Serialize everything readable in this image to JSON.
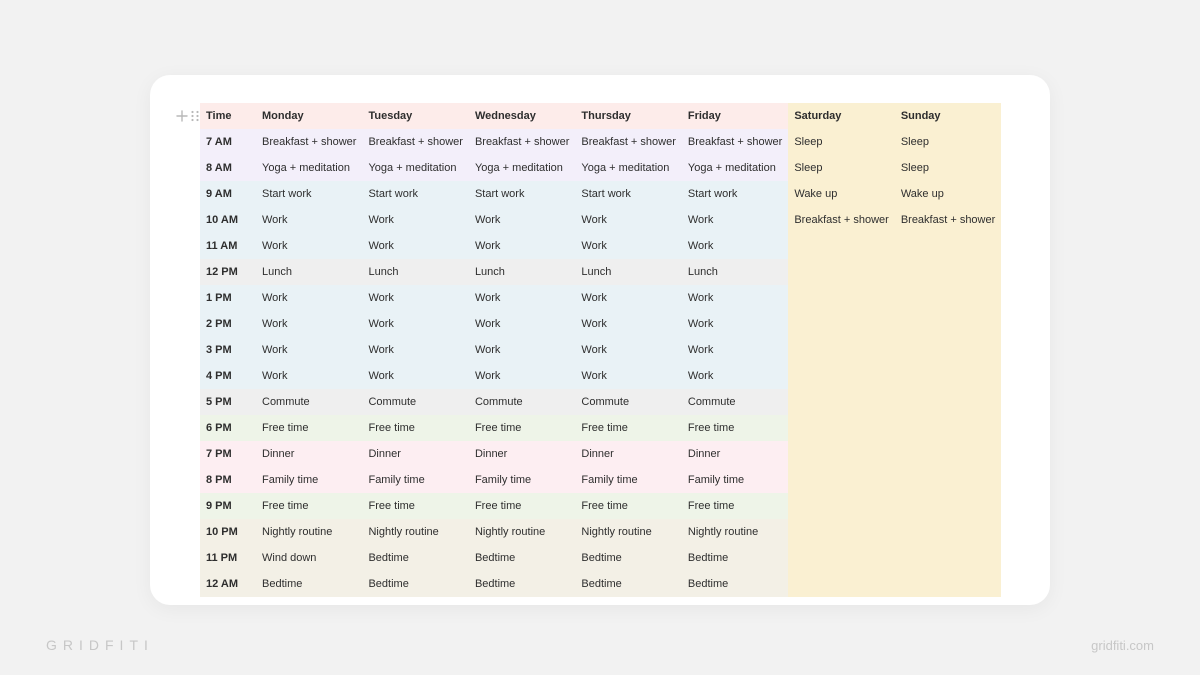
{
  "watermarks": {
    "left": "GRIDFITI",
    "right": "gridfiti.com"
  },
  "table": {
    "headers": [
      "Time",
      "Monday",
      "Tuesday",
      "Wednesday",
      "Thursday",
      "Friday",
      "Saturday",
      "Sunday"
    ],
    "rows": [
      {
        "time": "7 AM",
        "bg": "bg-lav",
        "cells": [
          "Breakfast + shower",
          "Breakfast + shower",
          "Breakfast + shower",
          "Breakfast + shower",
          "Breakfast + shower",
          "Sleep",
          "Sleep"
        ]
      },
      {
        "time": "8 AM",
        "bg": "bg-lav",
        "cells": [
          "Yoga + meditation",
          "Yoga + meditation",
          "Yoga + meditation",
          "Yoga + meditation",
          "Yoga + meditation",
          "Sleep",
          "Sleep"
        ]
      },
      {
        "time": "9 AM",
        "bg": "bg-blue",
        "cells": [
          "Start work",
          "Start work",
          "Start work",
          "Start work",
          "Start work",
          "Wake up",
          "Wake up"
        ]
      },
      {
        "time": "10 AM",
        "bg": "bg-blue",
        "cells": [
          "Work",
          "Work",
          "Work",
          "Work",
          "Work",
          "Breakfast + shower",
          "Breakfast + shower"
        ]
      },
      {
        "time": "11 AM",
        "bg": "bg-blue",
        "cells": [
          "Work",
          "Work",
          "Work",
          "Work",
          "Work",
          "",
          ""
        ]
      },
      {
        "time": "12 PM",
        "bg": "bg-grey",
        "cells": [
          "Lunch",
          "Lunch",
          "Lunch",
          "Lunch",
          "Lunch",
          "",
          ""
        ]
      },
      {
        "time": "1 PM",
        "bg": "bg-blue",
        "cells": [
          "Work",
          "Work",
          "Work",
          "Work",
          "Work",
          "",
          ""
        ]
      },
      {
        "time": "2 PM",
        "bg": "bg-blue",
        "cells": [
          "Work",
          "Work",
          "Work",
          "Work",
          "Work",
          "",
          ""
        ]
      },
      {
        "time": "3 PM",
        "bg": "bg-blue",
        "cells": [
          "Work",
          "Work",
          "Work",
          "Work",
          "Work",
          "",
          ""
        ]
      },
      {
        "time": "4 PM",
        "bg": "bg-blue",
        "cells": [
          "Work",
          "Work",
          "Work",
          "Work",
          "Work",
          "",
          ""
        ]
      },
      {
        "time": "5 PM",
        "bg": "bg-grey",
        "cells": [
          "Commute",
          "Commute",
          "Commute",
          "Commute",
          "Commute",
          "",
          ""
        ]
      },
      {
        "time": "6 PM",
        "bg": "bg-green",
        "cells": [
          "Free time",
          "Free time",
          "Free time",
          "Free time",
          "Free time",
          "",
          ""
        ]
      },
      {
        "time": "7 PM",
        "bg": "bg-pink",
        "cells": [
          "Dinner",
          "Dinner",
          "Dinner",
          "Dinner",
          "Dinner",
          "",
          ""
        ]
      },
      {
        "time": "8 PM",
        "bg": "bg-pink",
        "cells": [
          "Family time",
          "Family time",
          "Family time",
          "Family time",
          "Family time",
          "",
          ""
        ]
      },
      {
        "time": "9 PM",
        "bg": "bg-green",
        "cells": [
          "Free time",
          "Free time",
          "Free time",
          "Free time",
          "Free time",
          "",
          ""
        ]
      },
      {
        "time": "10 PM",
        "bg": "bg-cream",
        "cells": [
          "Nightly routine",
          "Nightly routine",
          "Nightly routine",
          "Nightly routine",
          "Nightly routine",
          "",
          ""
        ]
      },
      {
        "time": "11 PM",
        "bg": "bg-cream",
        "cells": [
          "Wind down",
          "Bedtime",
          "Bedtime",
          "Bedtime",
          "Bedtime",
          "",
          ""
        ]
      },
      {
        "time": "12 AM",
        "bg": "bg-cream",
        "cells": [
          "Bedtime",
          "Bedtime",
          "Bedtime",
          "Bedtime",
          "Bedtime",
          "",
          ""
        ]
      }
    ]
  }
}
